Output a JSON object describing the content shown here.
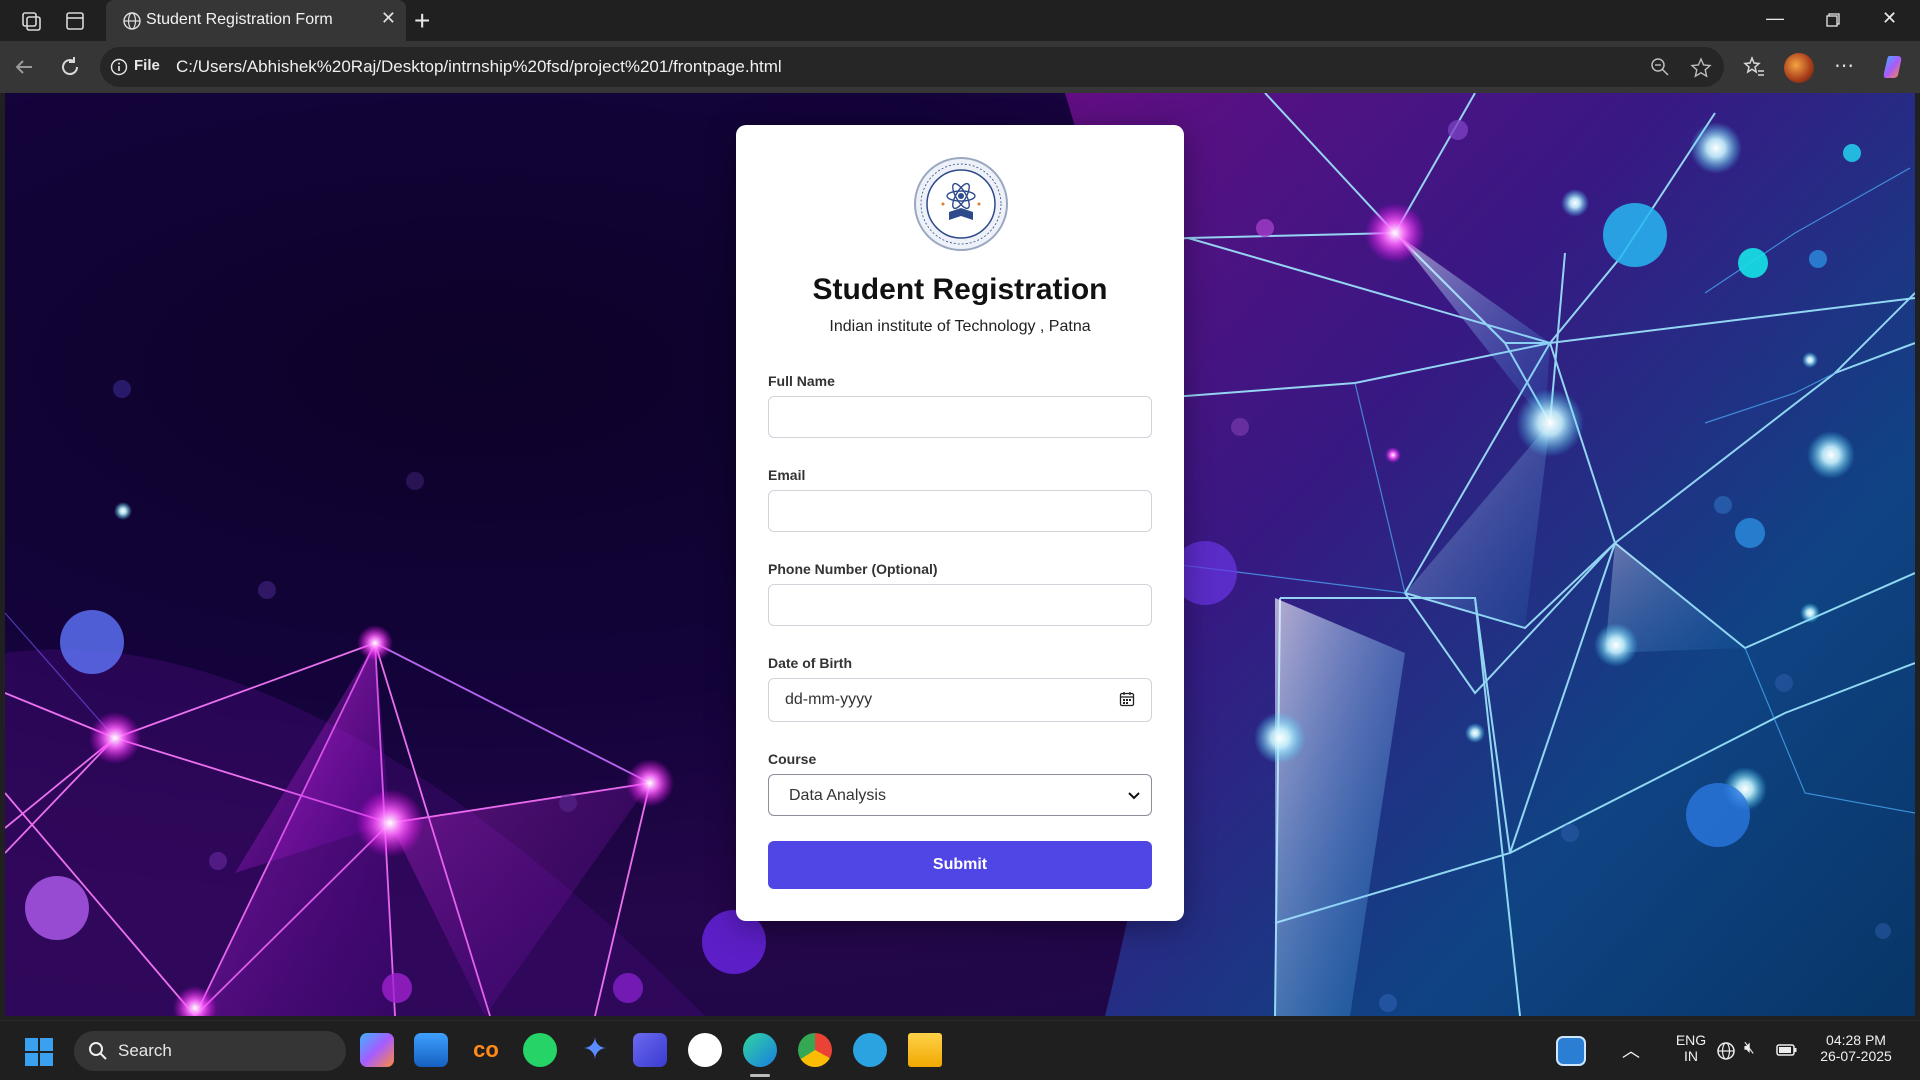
{
  "browser": {
    "tab_title": "Student Registration Form",
    "address_prefix": "File",
    "url": "C:/Users/Abhishek%20Raj/Desktop/intrnship%20fsd/project%201/frontpage.html"
  },
  "form": {
    "title": "Student Registration",
    "subtitle": "Indian institute of Technology , Patna",
    "fields": {
      "full_name": {
        "label": "Full Name",
        "value": ""
      },
      "email": {
        "label": "Email",
        "value": ""
      },
      "phone": {
        "label": "Phone Number (Optional)",
        "value": ""
      },
      "dob": {
        "label": "Date of Birth",
        "placeholder": "dd-mm-yyyy"
      },
      "course": {
        "label": "Course",
        "selected": "Data Analysis"
      }
    },
    "submit_label": "Submit",
    "accent_color": "#4f46e5"
  },
  "taskbar": {
    "search_placeholder": "Search",
    "apps": [
      "windows-start",
      "copilot",
      "media-app",
      "coursera",
      "whatsapp",
      "gemini",
      "vs-app",
      "chatgpt",
      "edge",
      "chrome",
      "telegram",
      "file-explorer"
    ],
    "language": "ENG",
    "region": "IN",
    "time": "04:28 PM",
    "date": "26-07-2025"
  }
}
